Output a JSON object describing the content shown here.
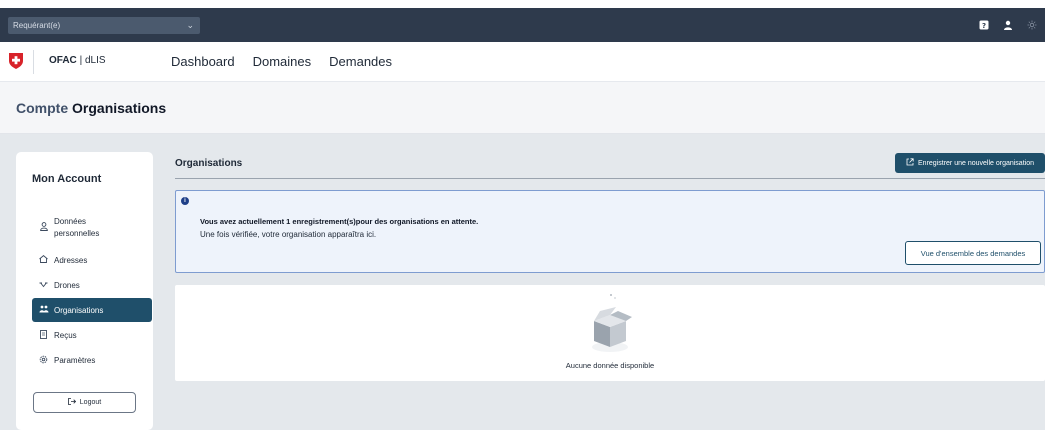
{
  "topbar": {
    "role_select": "Requérant(e)",
    "icons": [
      "help-icon",
      "user-icon",
      "sun-icon"
    ]
  },
  "brand": {
    "org": "OFAC",
    "separator": "|",
    "app": "dLIS"
  },
  "nav": {
    "items": [
      "Dashboard",
      "Domaines",
      "Demandes"
    ]
  },
  "page": {
    "breadcrumb": "Compte",
    "title": "Organisations"
  },
  "sidebar": {
    "title": "Mon Account",
    "items": [
      {
        "label": "Données personnelles",
        "icon": "person-icon"
      },
      {
        "label": "Adresses",
        "icon": "home-icon"
      },
      {
        "label": "Drones",
        "icon": "drone-icon"
      },
      {
        "label": "Organisations",
        "icon": "group-icon"
      },
      {
        "label": "Reçus",
        "icon": "receipt-icon"
      },
      {
        "label": "Paramètres",
        "icon": "gear-icon"
      }
    ],
    "logout": "Logout"
  },
  "content": {
    "title": "Organisations",
    "register_button": "Enregistrer une nouvelle organisation"
  },
  "alert": {
    "line1": "Vous avez actuellement 1 enregistrement(s)pour des organisations en attente.",
    "line2": "Une fois vérifiée, votre organisation apparaîtra ici.",
    "overview_button": "Vue d'ensemble des demandes"
  },
  "empty": {
    "text": "Aucune donnée disponible"
  },
  "colors": {
    "accent": "#1f4f6a",
    "topbar": "#2e3a4c",
    "swiss_red": "#d8232a"
  }
}
